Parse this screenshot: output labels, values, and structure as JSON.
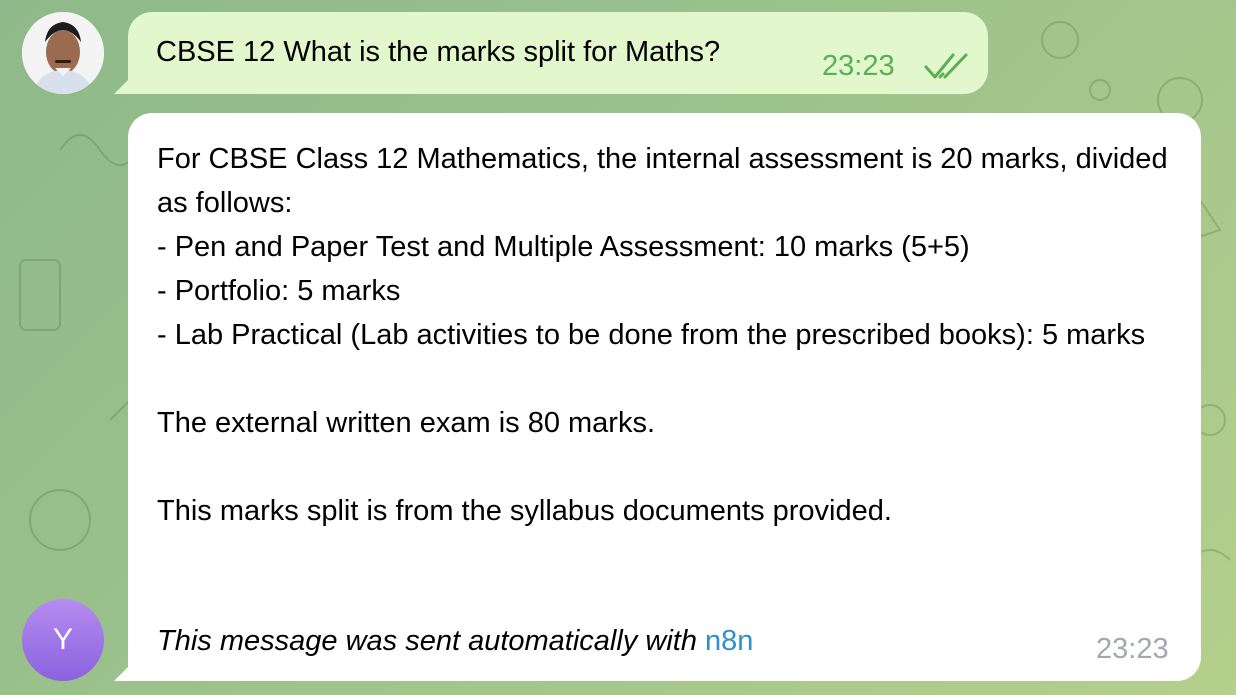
{
  "chat": {
    "outgoing": {
      "text": "CBSE 12 What is the marks split for Maths?",
      "time": "23:23",
      "status_icon": "double-check-icon"
    },
    "incoming": {
      "body": "For CBSE Class 12 Mathematics, the internal assessment is 20 marks, divided as follows:\n- Pen and Paper Test and Multiple Assessment: 10 marks (5+5)\n- Portfolio: 5 marks\n- Lab Practical (Lab activities to be done from the prescribed books): 5 marks\n\nThe external written exam is 80 marks.\n\nThis marks split is from the syllabus documents provided.",
      "footer_prefix": "This message was sent automatically with",
      "footer_link": "n8n",
      "time": "23:23"
    },
    "bot_avatar_letter": "Y"
  },
  "colors": {
    "outgoing_bubble": "#e2f7cc",
    "incoming_bubble": "#ffffff",
    "link": "#2f8fcf",
    "check": "#5cae55",
    "bot_avatar": "#8b62de"
  }
}
